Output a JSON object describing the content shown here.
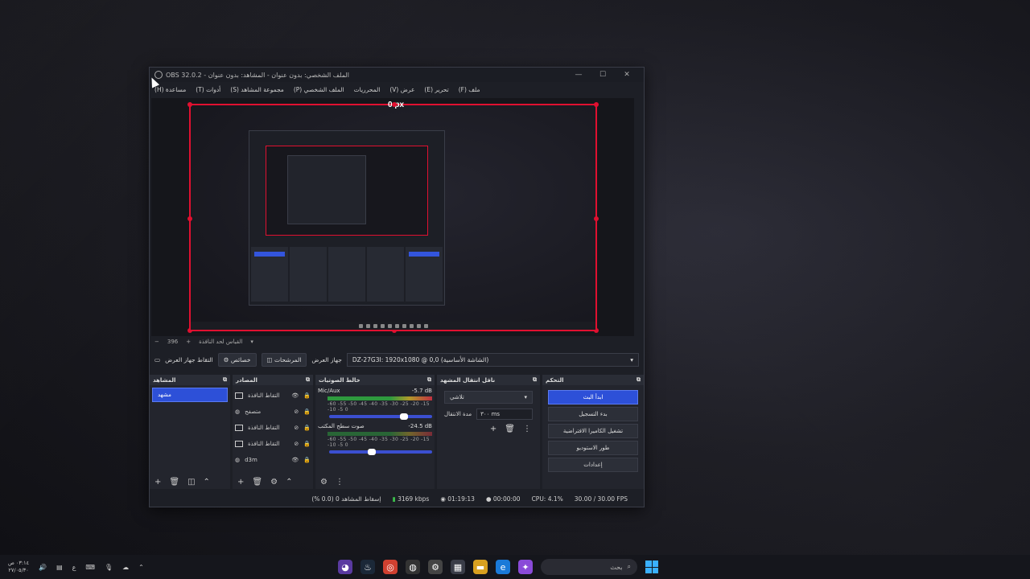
{
  "window": {
    "title": "OBS 32.0.2 - الملف الشخصي: بدون عنوان - المشاهد: بدون عنوان",
    "controls": [
      "—",
      "☐",
      "✕"
    ]
  },
  "menu": [
    "ملف (F)",
    "تحرير (E)",
    "عرض (V)",
    "المحرريات",
    "الملف الشخصي (P)",
    "مجموعة المشاهد (S)",
    "أدوات (T)",
    "مساعدة (H)"
  ],
  "preview": {
    "px_label": "0 px"
  },
  "zoom": {
    "minus": "−",
    "value": "396",
    "plus": "+",
    "fit": "القياس لحد النافذة"
  },
  "scene_bar": {
    "label": "التقاط جهاز العرض",
    "properties": "خصائص",
    "filters": "المرشحات",
    "device_label": "جهاز العرض",
    "display": "DZ-27G3I: 1920x1080 @ 0,0 (الشاشة الأساسية)"
  },
  "docks": {
    "scenes": {
      "title": "المشاهد",
      "items": [
        "مشهد"
      ]
    },
    "sources": {
      "title": "المصادر",
      "items": [
        "التقاط النافذة",
        "متصفح",
        "التقاط النافذة",
        "التقاط النافذة",
        "d3m"
      ]
    },
    "mixer": {
      "title": "خالط الصوتيات",
      "channels": [
        {
          "name": "Mic/Aux",
          "level": "-5.7 dB",
          "fader": 0.75
        },
        {
          "name": "صوت سطح المكتب",
          "level": "-24.5 dB",
          "fader": 0.4
        }
      ],
      "scale": "-60 -55 -50 -45 -40 -35 -30 -25 -20 -15 -10 -5 0"
    },
    "transitions": {
      "title": "ناقل انتقال المشهد",
      "selected": "تلاشي",
      "duration_label": "مدة الانتقال",
      "duration": "٣٠٠ ms"
    },
    "controls": {
      "title": "التحكم",
      "buttons": [
        "ابدأ البث",
        "بدء التسجيل",
        "تشغيل الكاميرا الافتراضية",
        "طور الاستوديو",
        "إعدادات"
      ]
    }
  },
  "status": {
    "dropped": "إسقاط المشاهد 0 (0.0 %)",
    "bitrate": "3169 kbps",
    "stream_time": "01:19:13",
    "rec_time": "00:00:00",
    "cpu": "CPU: 4.1%",
    "fps": "30.00 / 30.00 FPS"
  },
  "taskbar": {
    "time": "٠٣:١٤ ص",
    "date": "٢٧/٠٥/٣٠",
    "lang": "ع",
    "search": "بحث"
  },
  "colors": {
    "accent": "#2d50d8",
    "selection_red": "#e01030",
    "signal_green": "#3cc04c"
  }
}
